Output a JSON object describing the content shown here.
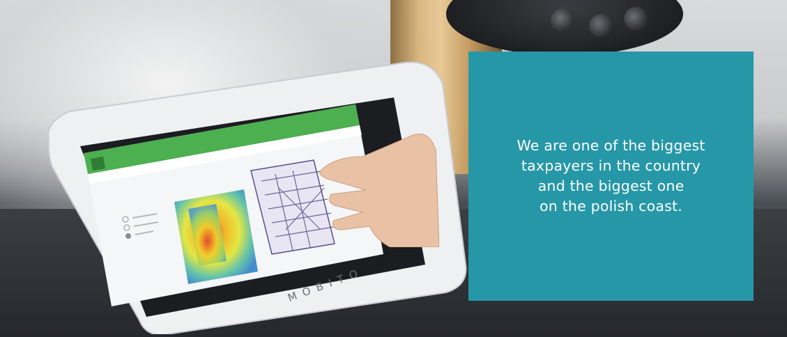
{
  "overlay": {
    "lines": [
      "We are one of the biggest",
      "taxpayers in the country",
      "and the biggest one",
      "on the polish coast."
    ],
    "background_color": "#2697a7",
    "text_color": "#ffffff"
  },
  "photo": {
    "device_brand": "MOBITO"
  }
}
